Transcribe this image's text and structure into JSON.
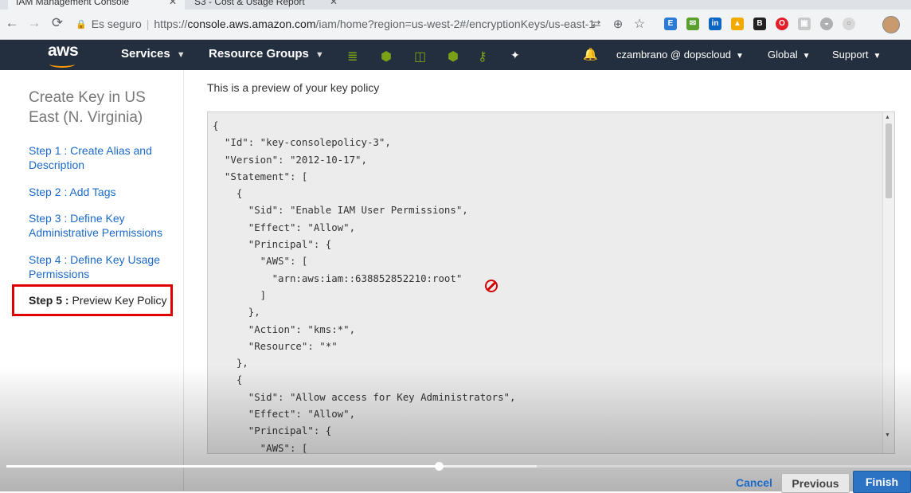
{
  "browser": {
    "tabs": [
      {
        "label": "IAM Management Console"
      },
      {
        "label": "S3 - Cost & Usage Report"
      }
    ],
    "back_icon": "arrow-left",
    "forward_icon": "arrow-right",
    "reload_icon": "reload",
    "security_label": "Es seguro",
    "url_prefix": "https://",
    "url_host": "console.aws.amazon.com",
    "url_path": "/iam/home?region=us-west-2#/encryptionKeys/us-east-1"
  },
  "aws_nav": {
    "logo": "aws",
    "services_label": "Services",
    "resource_groups_label": "Resource Groups",
    "user_label": "czambrano @ dopscloud",
    "region_label": "Global",
    "support_label": "Support"
  },
  "sidebar": {
    "title": "Create Key in US East (N. Virginia)",
    "steps": [
      {
        "label": "Step 1 : Create Alias and Description"
      },
      {
        "label": "Step 2 : Add Tags"
      },
      {
        "label": "Step 3 : Define Key Administrative Permissions"
      },
      {
        "label": "Step 4 : Define Key Usage Permissions"
      }
    ],
    "active_step_prefix": "Step 5 :",
    "active_step_label": "Preview Key Policy"
  },
  "main": {
    "intro": "This is a preview of your key policy",
    "policy_text": "{\n  \"Id\": \"key-consolepolicy-3\",\n  \"Version\": \"2012-10-17\",\n  \"Statement\": [\n    {\n      \"Sid\": \"Enable IAM User Permissions\",\n      \"Effect\": \"Allow\",\n      \"Principal\": {\n        \"AWS\": [\n          \"arn:aws:iam::638852852210:root\"\n        ]\n      },\n      \"Action\": \"kms:*\",\n      \"Resource\": \"*\"\n    },\n    {\n      \"Sid\": \"Allow access for Key Administrators\",\n      \"Effect\": \"Allow\",\n      \"Principal\": {\n        \"AWS\": [\n"
  },
  "footer": {
    "cancel_label": "Cancel",
    "previous_label": "Previous",
    "finish_label": "Finish"
  },
  "video": {
    "played_fraction": 0.478,
    "buffered_fraction": 0.586
  },
  "colors": {
    "aws_nav_bg": "#232f3e",
    "link_blue": "#1b6ac9",
    "highlight_red": "#e00000",
    "primary_button": "#2d73c4"
  }
}
